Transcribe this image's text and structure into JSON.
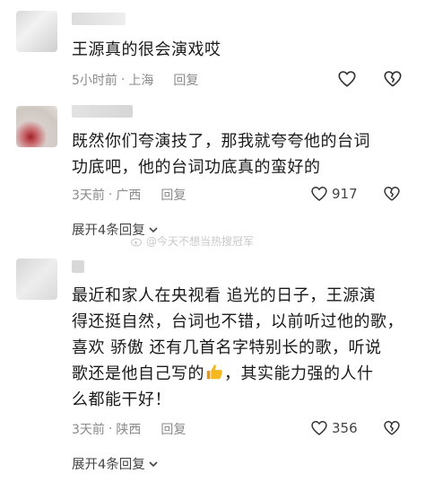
{
  "comments": [
    {
      "text": "王源真的很会演戏哎",
      "time": "5小时前",
      "location": "上海",
      "reply_label": "回复",
      "likes": ""
    },
    {
      "line1": "既然你们夸演技了，那我就夸夸他的台词",
      "line2": "功底吧，他的台词功底真的蛮好的",
      "time": "3天前",
      "location": "广西",
      "reply_label": "回复",
      "likes": "917",
      "expand_label": "展开4条回复"
    },
    {
      "line1": "最近和家人在央视看 追光的日子，王源演",
      "line2": "得还挺自然，台词也不错，以前听过他的歌，",
      "line3": "喜欢 骄傲 还有几首名字特别长的歌，听说",
      "line4a": "歌还是他自己写的",
      "line4b": "，其实能力强的人什",
      "line5": "么都能干好！",
      "time": "3天前",
      "location": "陕西",
      "reply_label": "回复",
      "likes": "356",
      "expand_label": "展开4条回复"
    }
  ],
  "watermark": "@今天不想当热搜冠军",
  "separator": "·",
  "icons": {
    "like": "heart-icon",
    "dislike": "broken-heart-icon",
    "expand": "chevron-down-icon",
    "emoji": "thumbs-up-emoji"
  },
  "colors": {
    "meta": "#8a8a8a",
    "text": "#1a1a1a",
    "emoji": "#f5b820"
  }
}
